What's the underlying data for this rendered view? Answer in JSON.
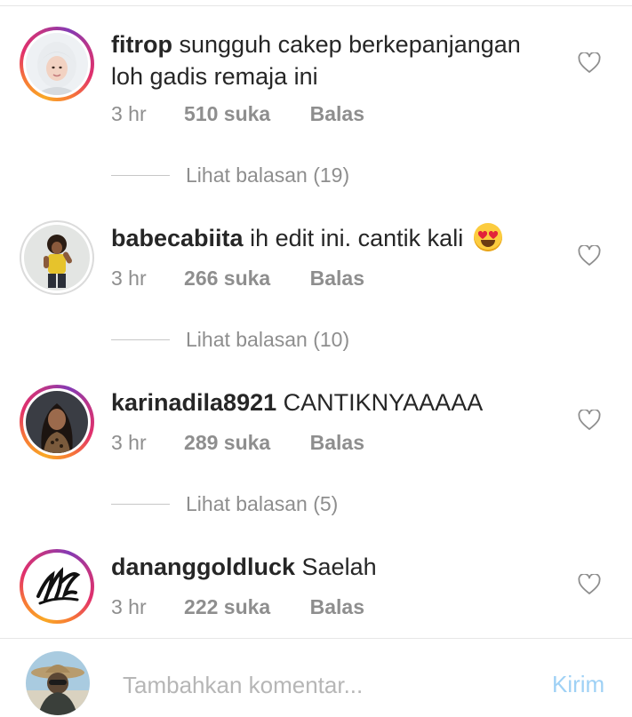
{
  "comments": [
    {
      "username": "fitrop",
      "text": "sungguh cakep berkepanjangan loh gadis remaja ini",
      "time": "3 hr",
      "likes": "510 suka",
      "reply_label": "Balas",
      "view_replies": "Lihat balasan (19)",
      "like_icon": "heart-outline-icon"
    },
    {
      "username": "babecabiita",
      "text": "ih edit ini. cantik kali",
      "emoji": "heart-eyes-emoji",
      "time": "3 hr",
      "likes": "266 suka",
      "reply_label": "Balas",
      "view_replies": "Lihat balasan (10)",
      "like_icon": "heart-outline-icon"
    },
    {
      "username": "karinadila8921",
      "text": "CANTIKNYAAAAA",
      "time": "3 hr",
      "likes": "289 suka",
      "reply_label": "Balas",
      "view_replies": "Lihat balasan (5)",
      "like_icon": "heart-outline-icon"
    },
    {
      "username": "dananggoldluck",
      "text": "Saelah",
      "time": "3 hr",
      "likes": "222 suka",
      "reply_label": "Balas",
      "like_icon": "heart-outline-icon"
    }
  ],
  "composer": {
    "placeholder": "Tambahkan komentar...",
    "send_label": "Kirim"
  },
  "colors": {
    "text": "#262626",
    "meta": "#8e8e8e",
    "placeholder": "#b6b6b6",
    "send_disabled": "#9fd1f5",
    "divider": "#e6e6e6"
  }
}
